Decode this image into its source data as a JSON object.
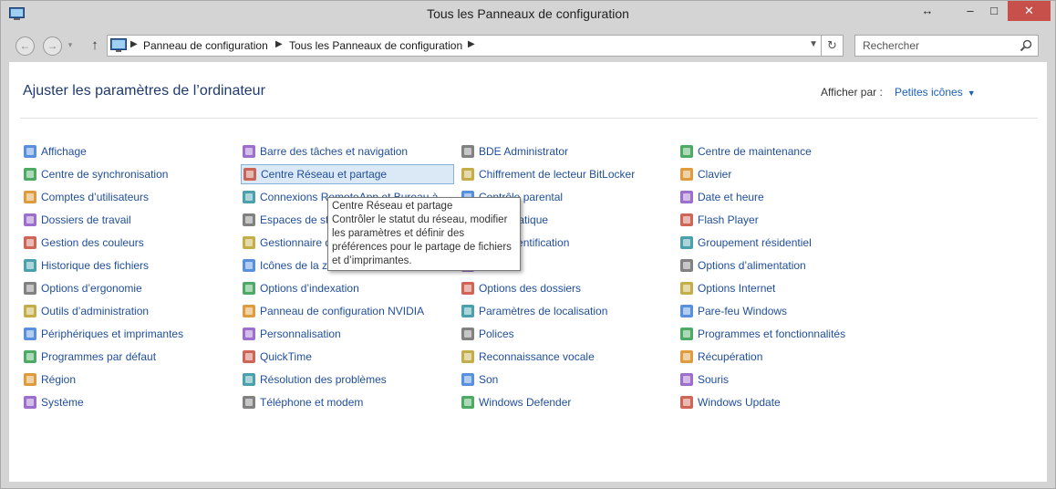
{
  "window": {
    "title": "Tous les Panneaux de configuration",
    "close_label": "✕"
  },
  "nav": {
    "breadcrumbs": [
      "Panneau de configuration",
      "Tous les Panneaux de configuration"
    ],
    "search_placeholder": "Rechercher"
  },
  "header": {
    "title": "Ajuster les paramètres de l’ordinateur",
    "view_by_label": "Afficher par :",
    "view_by_value": "Petites icônes"
  },
  "columns": [
    [
      {
        "label": "Affichage",
        "icon": "display-icon"
      },
      {
        "label": "Centre de synchronisation",
        "icon": "sync-center-icon"
      },
      {
        "label": "Comptes d’utilisateurs",
        "icon": "user-accounts-icon"
      },
      {
        "label": "Dossiers de travail",
        "icon": "work-folders-icon"
      },
      {
        "label": "Gestion des couleurs",
        "icon": "color-management-icon"
      },
      {
        "label": "Historique des fichiers",
        "icon": "file-history-icon"
      },
      {
        "label": "Options d’ergonomie",
        "icon": "ease-of-access-icon"
      },
      {
        "label": "Outils d’administration",
        "icon": "admin-tools-icon"
      },
      {
        "label": "Périphériques et imprimantes",
        "icon": "devices-printers-icon"
      },
      {
        "label": "Programmes par défaut",
        "icon": "default-programs-icon"
      },
      {
        "label": "Région",
        "icon": "region-icon"
      },
      {
        "label": "Système",
        "icon": "system-icon"
      }
    ],
    [
      {
        "label": "Barre des tâches et navigation",
        "icon": "taskbar-icon"
      },
      {
        "label": "Centre Réseau et partage",
        "icon": "network-center-icon"
      },
      {
        "label": "Connexions RemoteApp et Bureau à",
        "icon": "remoteapp-icon"
      },
      {
        "label": "Espaces de sto",
        "icon": "storage-spaces-icon"
      },
      {
        "label": "Gestionnaire d",
        "icon": "device-manager-icon"
      },
      {
        "label": "Icônes de la zo",
        "icon": "notification-icons-icon"
      },
      {
        "label": "Options d’indexation",
        "icon": "indexing-icon"
      },
      {
        "label": "Panneau de configuration NVIDIA",
        "icon": "nvidia-icon"
      },
      {
        "label": "Personnalisation",
        "icon": "personalization-icon"
      },
      {
        "label": "QuickTime",
        "icon": "quicktime-icon"
      },
      {
        "label": "Résolution des problèmes",
        "icon": "troubleshooting-icon"
      },
      {
        "label": "Téléphone et modem",
        "icon": "phone-modem-icon"
      }
    ],
    [
      {
        "label": "BDE Administrator",
        "icon": "bde-admin-icon"
      },
      {
        "label": "Chiffrement de lecteur BitLocker",
        "icon": "bitlocker-icon"
      },
      {
        "label": "Contrôle parental",
        "icon": "parental-control-icon"
      },
      {
        "label": "n automatique",
        "icon": "autoplay-icon"
      },
      {
        "label": "aire d’identification",
        "icon": "credential-manager-icon"
      },
      {
        "label": "",
        "icon": "hidden-item-icon"
      },
      {
        "label": "Options des dossiers",
        "icon": "folder-options-icon"
      },
      {
        "label": "Paramètres de localisation",
        "icon": "location-settings-icon"
      },
      {
        "label": "Polices",
        "icon": "fonts-icon"
      },
      {
        "label": "Reconnaissance vocale",
        "icon": "speech-recognition-icon"
      },
      {
        "label": "Son",
        "icon": "sound-icon"
      },
      {
        "label": "Windows Defender",
        "icon": "windows-defender-icon"
      }
    ],
    [
      {
        "label": "Centre de maintenance",
        "icon": "action-center-icon"
      },
      {
        "label": "Clavier",
        "icon": "keyboard-icon"
      },
      {
        "label": "Date et heure",
        "icon": "date-time-icon"
      },
      {
        "label": "Flash Player",
        "icon": "flash-player-icon"
      },
      {
        "label": "Groupement résidentiel",
        "icon": "homegroup-icon"
      },
      {
        "label": "Options d’alimentation",
        "icon": "power-options-icon"
      },
      {
        "label": "Options Internet",
        "icon": "internet-options-icon"
      },
      {
        "label": "Pare-feu Windows",
        "icon": "firewall-icon"
      },
      {
        "label": "Programmes et fonctionnalités",
        "icon": "programs-features-icon"
      },
      {
        "label": "Récupération",
        "icon": "recovery-icon"
      },
      {
        "label": "Souris",
        "icon": "mouse-icon"
      },
      {
        "label": "Windows Update",
        "icon": "windows-update-icon"
      }
    ]
  ],
  "tooltip": {
    "title": "Centre Réseau et partage",
    "lines": [
      "Contrôler le statut du réseau, modifier",
      "les paramètres et définir des",
      "préférences pour le partage de fichiers",
      "et d’imprimantes."
    ]
  },
  "colors": {
    "link": "#1f4e9b",
    "heading": "#1e3a6e",
    "accent": "#1a5fb4",
    "close_button": "#c7504b",
    "selection": "#dbe8f5"
  }
}
